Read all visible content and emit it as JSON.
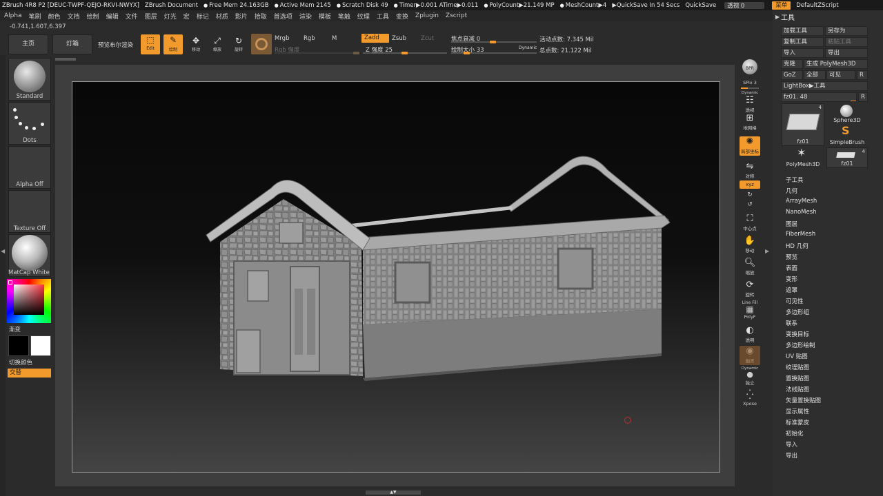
{
  "titlebar": {
    "app": "ZBrush 4R8 P2 [DEUC-TWPF-QEJO-RKVI-NWYX]",
    "document": "ZBrush Document",
    "free_mem": "Free Mem 24.163GB",
    "active_mem": "Active Mem 2145",
    "scratch": "Scratch Disk 49",
    "timer": "Timer▶0.001 ATime▶0.011",
    "polycount": "PolyCount▶21.149 MP",
    "meshcount": "MeshCount▶4",
    "quicksave_in": "▶QuickSave In 54 Secs",
    "quicksave": "QuickSave",
    "transparency": "透视 0",
    "menus_btn": "菜单",
    "script": "DefaultZScript"
  },
  "menubar": [
    "Alpha",
    "笔刷",
    "颜色",
    "文档",
    "绘制",
    "编辑",
    "文件",
    "图层",
    "灯光",
    "宏",
    "标记",
    "材质",
    "影片",
    "拾取",
    "首选项",
    "渲染",
    "模板",
    "笔触",
    "纹理",
    "工具",
    "变换",
    "Zplugin",
    "Zscript"
  ],
  "coords": "-0.741,1.607,6.397",
  "shelf": {
    "home": "主页",
    "lightbox": "灯箱",
    "preview_render": "预览布尔渲染",
    "edit": "Edit",
    "draw": "绘制",
    "move": "移动",
    "scale": "缩放",
    "rotate": "旋转",
    "mrgb": "Mrgb",
    "rgb": "Rgb",
    "m": "M",
    "rgb_intensity": "Rgb 强度",
    "zadd": "Zadd",
    "zsub": "Zsub",
    "zcut": "Zcut",
    "z_intensity": "Z 强度 25",
    "focal_shift": "焦点衰减 0",
    "draw_size": "绘制大小 33",
    "dynamic": "Dynamic",
    "active_points": "活动点数: 7.345 Mil",
    "total_points": "总点数: 21.122 Mil"
  },
  "leftpanel": {
    "brush": "Standard",
    "stroke": "Dots",
    "alpha": "Alpha Off",
    "texture": "Texture Off",
    "material": "MatCap White C",
    "gradient": "渐变",
    "switch_color": "切换颜色",
    "alternate": "交替"
  },
  "rightstrip": {
    "bpr": "BPR",
    "spix": "SPix 3",
    "dynamic": "Dynamic",
    "persp": "透视",
    "floor": "地网格",
    "local": "局部坐标",
    "l_sym": "对称",
    "xyz": "xyz",
    "frame": "中心点",
    "move": "移动",
    "zoom": "缩放",
    "rotate": "旋转",
    "linefill": "Line Fill",
    "polyf": "PolyF",
    "transp": "透明",
    "ghost": "幽灵",
    "dynamic2": "Dynamic",
    "solo": "独立",
    "xpose": "Xpose"
  },
  "toolpanel": {
    "title": "工具",
    "load": "加载工具",
    "save_as": "另存为",
    "copy": "复制工具",
    "paste": "粘贴工具",
    "import": "导入",
    "export": "导出",
    "clone": "克隆",
    "make_polymesh": "生成 PolyMesh3D",
    "goz": "GoZ",
    "all": "全部",
    "visible": "可见",
    "r": "R",
    "lightbox_tools": "LightBox▶工具",
    "current_tool": "fz01. 48",
    "thumbs": [
      {
        "label": "fz01",
        "count": "4"
      },
      {
        "label": "Sphere3D",
        "count": ""
      },
      {
        "label": "SimpleBrush",
        "count": ""
      },
      {
        "label": "PolyMesh3D",
        "count": ""
      },
      {
        "label": "fz01",
        "count": "4"
      }
    ],
    "items": [
      "子工具",
      "几何",
      "ArrayMesh",
      "NanoMesh",
      "图层",
      "FiberMesh",
      "HD 几何",
      "预览",
      "表面",
      "变形",
      "遮罩",
      "可见性",
      "多边形组",
      "联系",
      "变换目标",
      "多边形绘制",
      "UV 贴图",
      "纹理贴图",
      "置换贴图",
      "法线贴图",
      "矢量置换贴图",
      "显示属性",
      "标准蒙皮",
      "初始化",
      "导入",
      "导出"
    ]
  },
  "colors": {
    "accent": "#f39a2c",
    "bg": "#2b2b2b",
    "canvas": "#0a0a0a"
  }
}
